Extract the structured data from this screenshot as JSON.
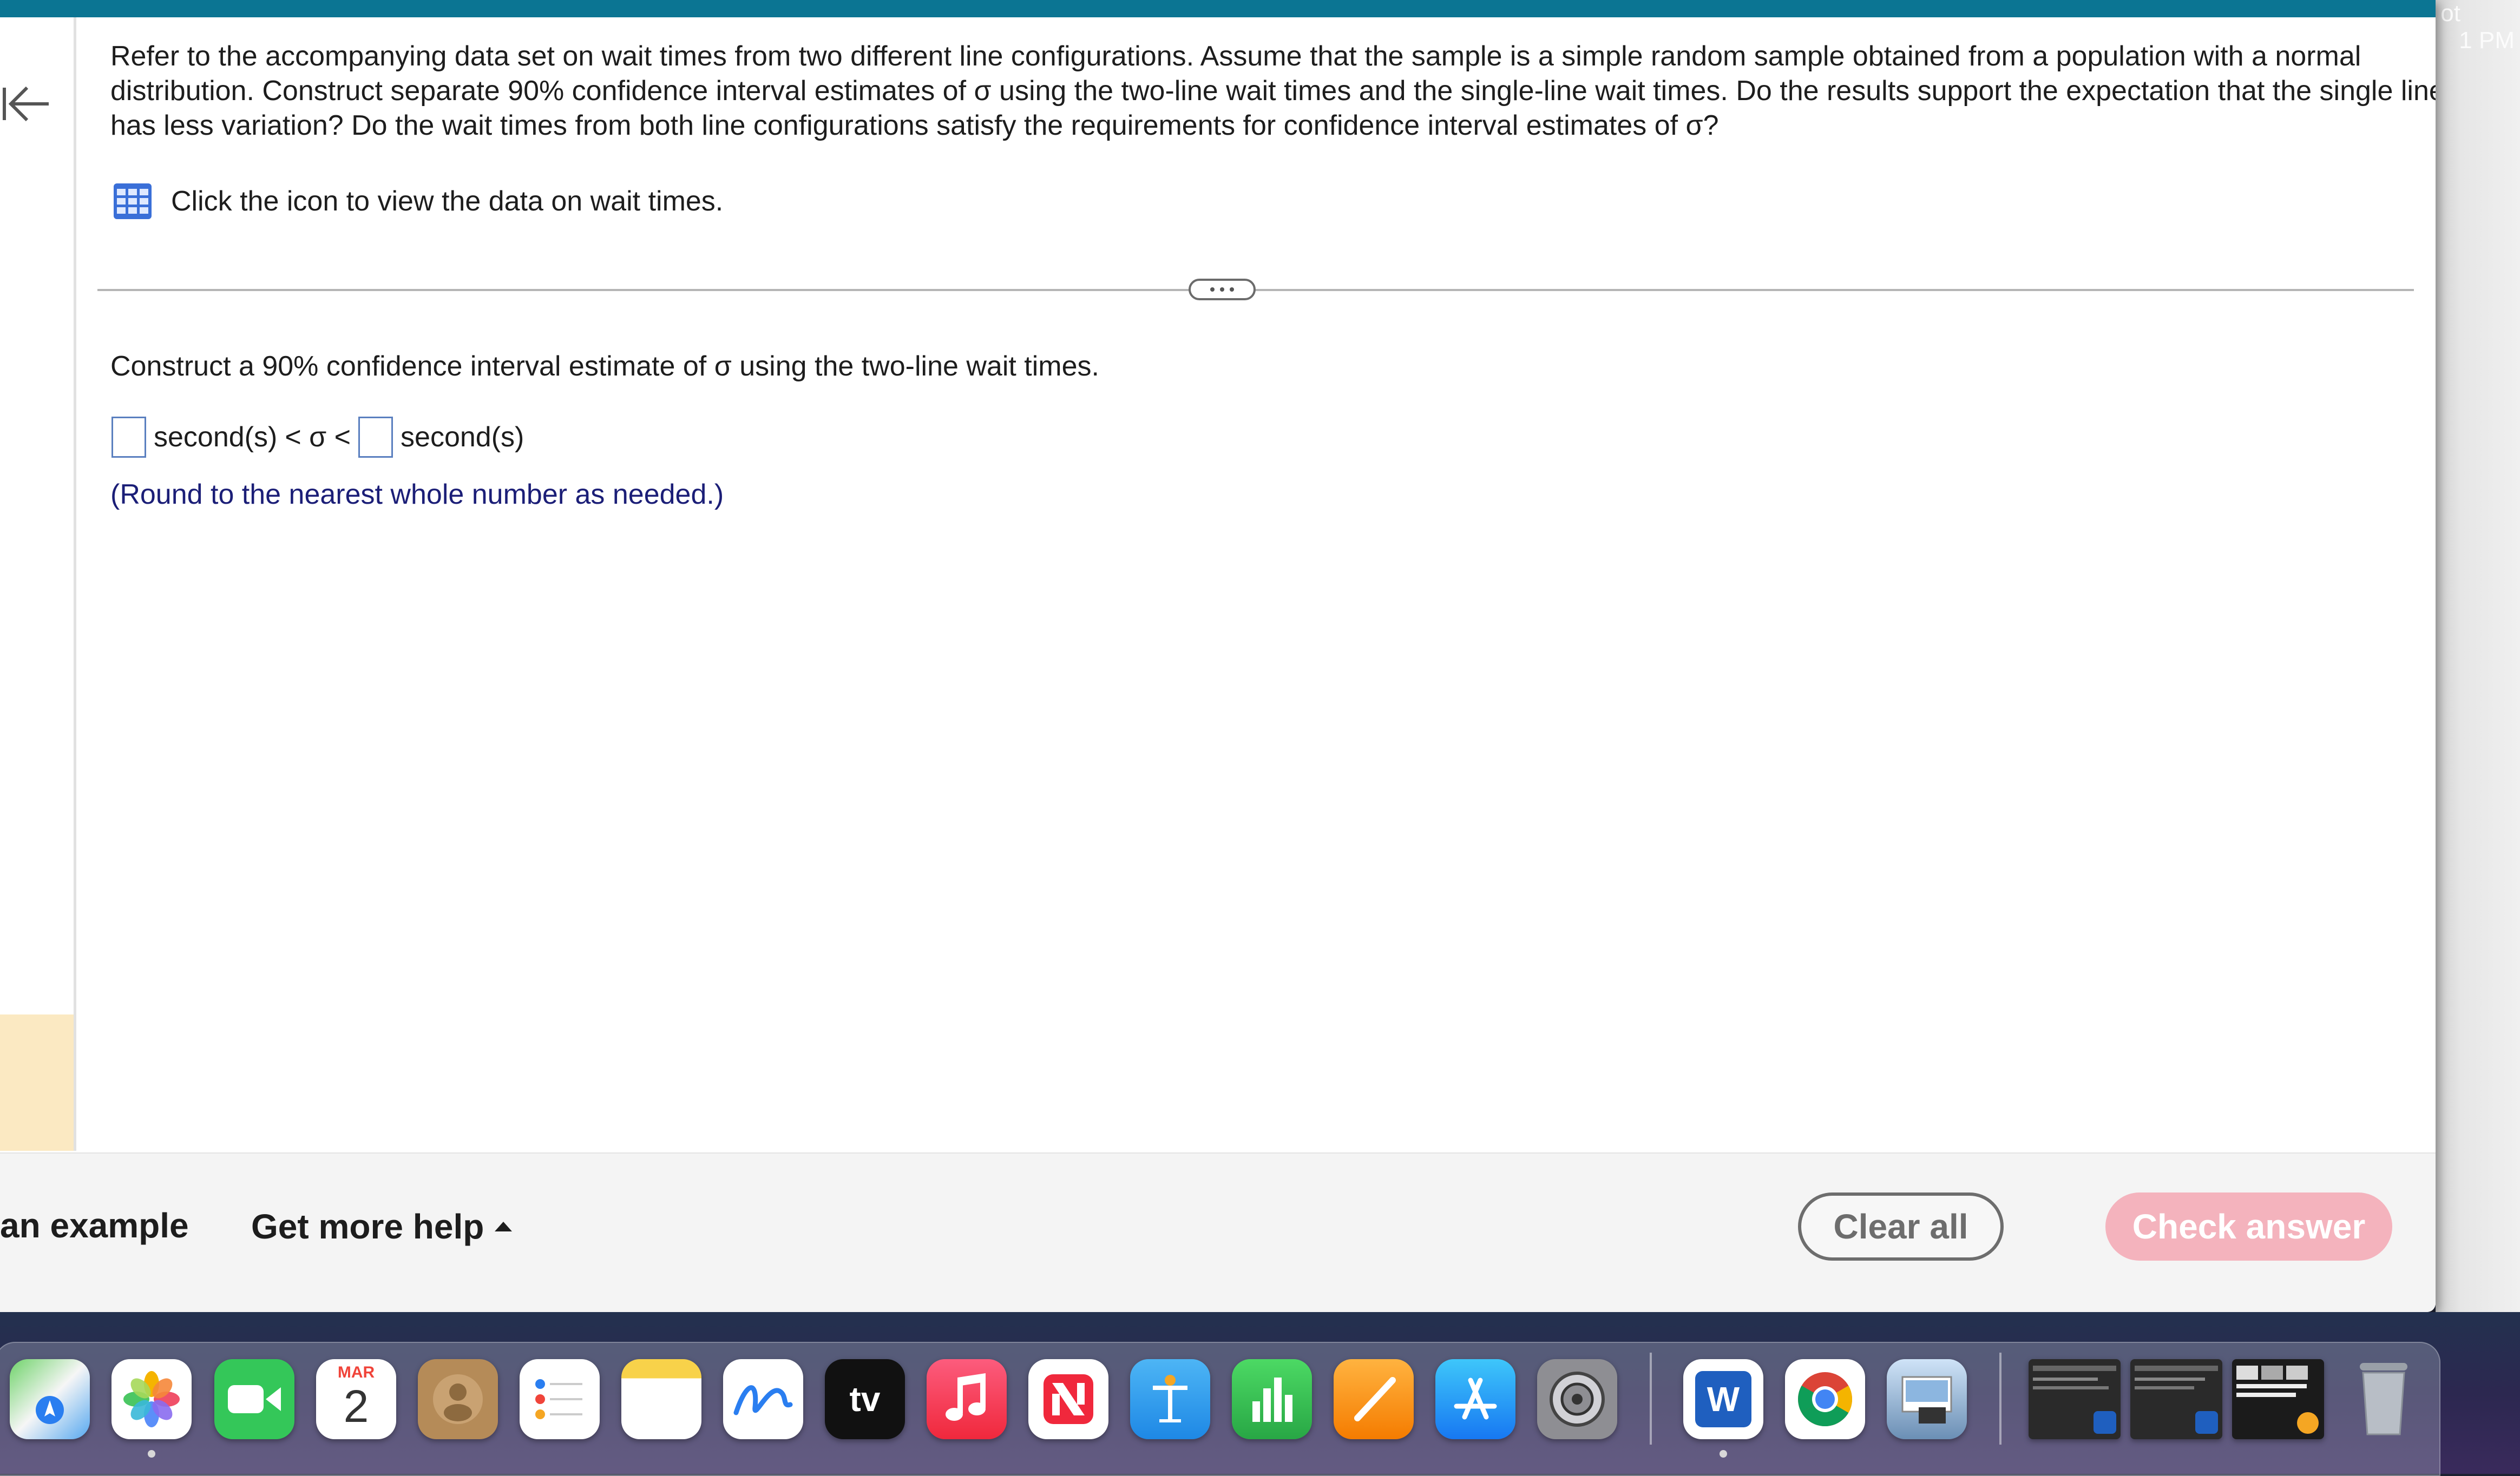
{
  "desktop": {
    "clock_fragment": "1 PM",
    "clock_top_fragment": "ot"
  },
  "question": {
    "text": "Refer to the accompanying data set on wait times from two different line configurations. Assume that the sample is a simple random sample obtained from a population with a normal distribution. Construct separate 90% confidence interval estimates of σ using the two-line wait times and the single-line wait times. Do the results support the expectation that the single line has less variation? Do the wait times from both line configurations satisfy the requirements for confidence interval estimates of σ?"
  },
  "data_link": {
    "text": "Click the icon to view the data on wait times.",
    "icon": "grid-table-icon"
  },
  "part": {
    "prompt": "Construct a 90% confidence interval estimate of σ using the two-line wait times.",
    "lower_value": "",
    "upper_value": "",
    "unit_1": "second(s)",
    "unit_2": "second(s)",
    "relation": "< σ <",
    "hint": "(Round to the nearest whole number as needed.)"
  },
  "bottom_bar": {
    "example_label": "an example",
    "help_label": "Get more help",
    "clear_label": "Clear all",
    "check_label": "Check answer"
  },
  "colors": {
    "topbar": "#0b7593",
    "hint_text": "#1b1e77",
    "check_button": "#f4b3bd",
    "input_border": "#5a7fbf"
  },
  "dock": {
    "calendar_month": "MAR",
    "calendar_day": "2",
    "tv_label": "tv",
    "word_letter": "W",
    "apps": [
      "maps-icon",
      "photos-icon",
      "facetime-icon",
      "calendar-icon",
      "contacts-icon",
      "reminders-icon",
      "notes-icon",
      "freeform-icon",
      "apple-tv-icon",
      "music-icon",
      "news-icon",
      "keynote-icon",
      "numbers-icon",
      "pages-icon",
      "app-store-icon",
      "system-settings-icon",
      "word-icon",
      "chrome-icon",
      "preview-icon",
      "window-thumb-1",
      "window-thumb-2",
      "window-thumb-3",
      "trash-icon"
    ]
  }
}
